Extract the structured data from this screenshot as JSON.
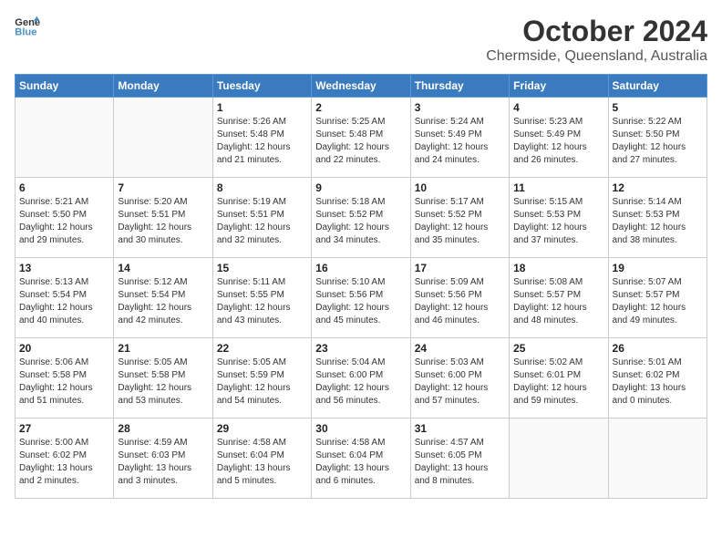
{
  "header": {
    "logo_line1": "General",
    "logo_line2": "Blue",
    "month_title": "October 2024",
    "subtitle": "Chermside, Queensland, Australia"
  },
  "weekdays": [
    "Sunday",
    "Monday",
    "Tuesday",
    "Wednesday",
    "Thursday",
    "Friday",
    "Saturday"
  ],
  "weeks": [
    [
      {
        "day": "",
        "info": ""
      },
      {
        "day": "",
        "info": ""
      },
      {
        "day": "1",
        "info": "Sunrise: 5:26 AM\nSunset: 5:48 PM\nDaylight: 12 hours\nand 21 minutes."
      },
      {
        "day": "2",
        "info": "Sunrise: 5:25 AM\nSunset: 5:48 PM\nDaylight: 12 hours\nand 22 minutes."
      },
      {
        "day": "3",
        "info": "Sunrise: 5:24 AM\nSunset: 5:49 PM\nDaylight: 12 hours\nand 24 minutes."
      },
      {
        "day": "4",
        "info": "Sunrise: 5:23 AM\nSunset: 5:49 PM\nDaylight: 12 hours\nand 26 minutes."
      },
      {
        "day": "5",
        "info": "Sunrise: 5:22 AM\nSunset: 5:50 PM\nDaylight: 12 hours\nand 27 minutes."
      }
    ],
    [
      {
        "day": "6",
        "info": "Sunrise: 5:21 AM\nSunset: 5:50 PM\nDaylight: 12 hours\nand 29 minutes."
      },
      {
        "day": "7",
        "info": "Sunrise: 5:20 AM\nSunset: 5:51 PM\nDaylight: 12 hours\nand 30 minutes."
      },
      {
        "day": "8",
        "info": "Sunrise: 5:19 AM\nSunset: 5:51 PM\nDaylight: 12 hours\nand 32 minutes."
      },
      {
        "day": "9",
        "info": "Sunrise: 5:18 AM\nSunset: 5:52 PM\nDaylight: 12 hours\nand 34 minutes."
      },
      {
        "day": "10",
        "info": "Sunrise: 5:17 AM\nSunset: 5:52 PM\nDaylight: 12 hours\nand 35 minutes."
      },
      {
        "day": "11",
        "info": "Sunrise: 5:15 AM\nSunset: 5:53 PM\nDaylight: 12 hours\nand 37 minutes."
      },
      {
        "day": "12",
        "info": "Sunrise: 5:14 AM\nSunset: 5:53 PM\nDaylight: 12 hours\nand 38 minutes."
      }
    ],
    [
      {
        "day": "13",
        "info": "Sunrise: 5:13 AM\nSunset: 5:54 PM\nDaylight: 12 hours\nand 40 minutes."
      },
      {
        "day": "14",
        "info": "Sunrise: 5:12 AM\nSunset: 5:54 PM\nDaylight: 12 hours\nand 42 minutes."
      },
      {
        "day": "15",
        "info": "Sunrise: 5:11 AM\nSunset: 5:55 PM\nDaylight: 12 hours\nand 43 minutes."
      },
      {
        "day": "16",
        "info": "Sunrise: 5:10 AM\nSunset: 5:56 PM\nDaylight: 12 hours\nand 45 minutes."
      },
      {
        "day": "17",
        "info": "Sunrise: 5:09 AM\nSunset: 5:56 PM\nDaylight: 12 hours\nand 46 minutes."
      },
      {
        "day": "18",
        "info": "Sunrise: 5:08 AM\nSunset: 5:57 PM\nDaylight: 12 hours\nand 48 minutes."
      },
      {
        "day": "19",
        "info": "Sunrise: 5:07 AM\nSunset: 5:57 PM\nDaylight: 12 hours\nand 49 minutes."
      }
    ],
    [
      {
        "day": "20",
        "info": "Sunrise: 5:06 AM\nSunset: 5:58 PM\nDaylight: 12 hours\nand 51 minutes."
      },
      {
        "day": "21",
        "info": "Sunrise: 5:05 AM\nSunset: 5:58 PM\nDaylight: 12 hours\nand 53 minutes."
      },
      {
        "day": "22",
        "info": "Sunrise: 5:05 AM\nSunset: 5:59 PM\nDaylight: 12 hours\nand 54 minutes."
      },
      {
        "day": "23",
        "info": "Sunrise: 5:04 AM\nSunset: 6:00 PM\nDaylight: 12 hours\nand 56 minutes."
      },
      {
        "day": "24",
        "info": "Sunrise: 5:03 AM\nSunset: 6:00 PM\nDaylight: 12 hours\nand 57 minutes."
      },
      {
        "day": "25",
        "info": "Sunrise: 5:02 AM\nSunset: 6:01 PM\nDaylight: 12 hours\nand 59 minutes."
      },
      {
        "day": "26",
        "info": "Sunrise: 5:01 AM\nSunset: 6:02 PM\nDaylight: 13 hours\nand 0 minutes."
      }
    ],
    [
      {
        "day": "27",
        "info": "Sunrise: 5:00 AM\nSunset: 6:02 PM\nDaylight: 13 hours\nand 2 minutes."
      },
      {
        "day": "28",
        "info": "Sunrise: 4:59 AM\nSunset: 6:03 PM\nDaylight: 13 hours\nand 3 minutes."
      },
      {
        "day": "29",
        "info": "Sunrise: 4:58 AM\nSunset: 6:04 PM\nDaylight: 13 hours\nand 5 minutes."
      },
      {
        "day": "30",
        "info": "Sunrise: 4:58 AM\nSunset: 6:04 PM\nDaylight: 13 hours\nand 6 minutes."
      },
      {
        "day": "31",
        "info": "Sunrise: 4:57 AM\nSunset: 6:05 PM\nDaylight: 13 hours\nand 8 minutes."
      },
      {
        "day": "",
        "info": ""
      },
      {
        "day": "",
        "info": ""
      }
    ]
  ]
}
